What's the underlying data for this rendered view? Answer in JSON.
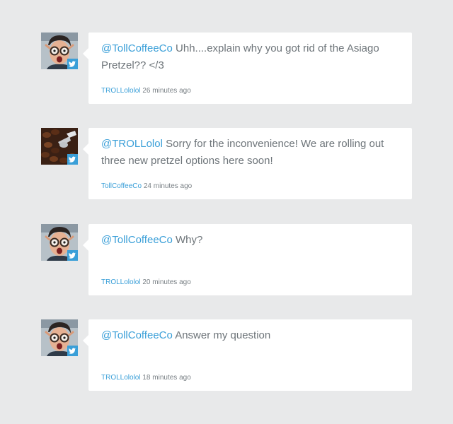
{
  "tweets": [
    {
      "mention": "@TollCoffeeCo",
      "text": "Uhh....explain why you got rid of the Asiago Pretzel?? </3",
      "author": "TROLLololol",
      "time": "26 minutes ago",
      "avatar": "troll-face-icon"
    },
    {
      "mention": "@TROLLolol",
      "text": "Sorry for the inconvenience! We are rolling out three new pretzel options here soon!",
      "author": "TollCoffeeCo",
      "time": "24 minutes ago",
      "avatar": "coffee-beans-icon"
    },
    {
      "mention": "@TollCoffeeCo",
      "text": "Why?",
      "author": "TROLLololol",
      "time": "20 minutes ago",
      "avatar": "troll-face-icon"
    },
    {
      "mention": "@TollCoffeeCo",
      "text": "Answer my question",
      "author": "TROLLololol",
      "time": "18 minutes ago",
      "avatar": "troll-face-icon"
    }
  ],
  "colors": {
    "background": "#e8e9ea",
    "bubble": "#ffffff",
    "accent": "#3a9fd8",
    "text": "#6d7479"
  },
  "badge_icon": "twitter-bird-icon"
}
